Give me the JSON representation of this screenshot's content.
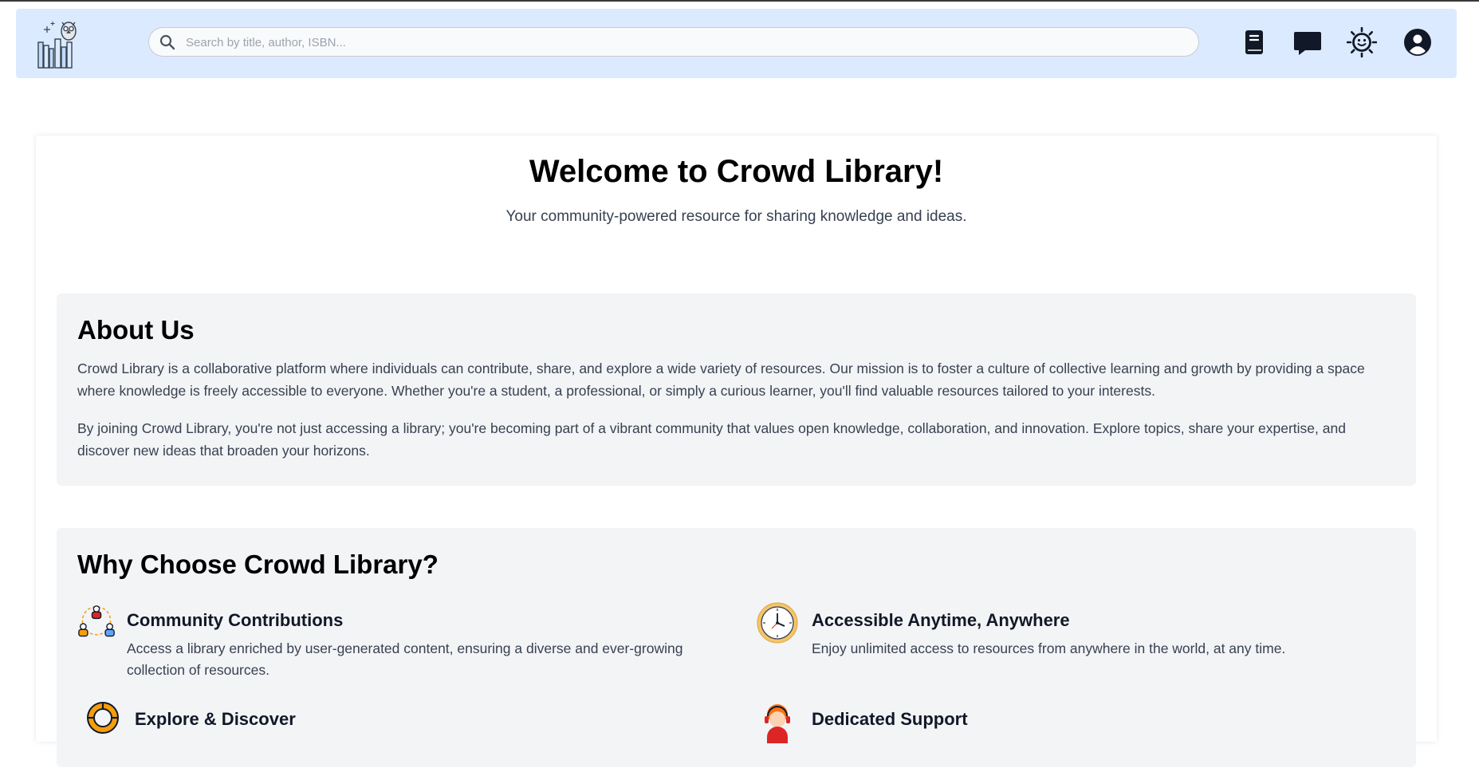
{
  "header": {
    "search_placeholder": "Search by title, author, ISBN...",
    "icons": [
      "owl-books-logo",
      "book-icon",
      "chat-icon",
      "sun-icon",
      "user-circle-icon"
    ]
  },
  "hero": {
    "title": "Welcome to Crowd Library!",
    "tagline": "Your community-powered resource for sharing knowledge and ideas."
  },
  "about": {
    "heading": "About Us",
    "paragraphs": [
      "Crowd Library is a collaborative platform where individuals can contribute, share, and explore a wide variety of resources. Our mission is to foster a culture of collective learning and growth by providing a space where knowledge is freely accessible to everyone. Whether you're a student, a professional, or simply a curious learner, you'll find valuable resources tailored to your interests.",
      "By joining Crowd Library, you're not just accessing a library; you're becoming part of a vibrant community that values open knowledge, collaboration, and innovation. Explore topics, share your expertise, and discover new ideas that broaden your horizons."
    ]
  },
  "why": {
    "heading": "Why Choose Crowd Library?",
    "features": [
      {
        "title": "Community Contributions",
        "description": "Access a library enriched by user-generated content, ensuring a diverse and ever-growing collection of resources.",
        "icon": "community-icon"
      },
      {
        "title": "Accessible Anytime, Anywhere",
        "description": "Enjoy unlimited access to resources from anywhere in the world, at any time.",
        "icon": "clock-icon"
      },
      {
        "title": "Explore & Discover",
        "description": "",
        "icon": "lifebuoy-icon"
      },
      {
        "title": "Dedicated Support",
        "description": "",
        "icon": "support-agent-icon"
      }
    ]
  },
  "colors": {
    "header_bg": "#dbeafe",
    "panel_bg": "#f3f4f6",
    "icon_dark": "#111827"
  }
}
